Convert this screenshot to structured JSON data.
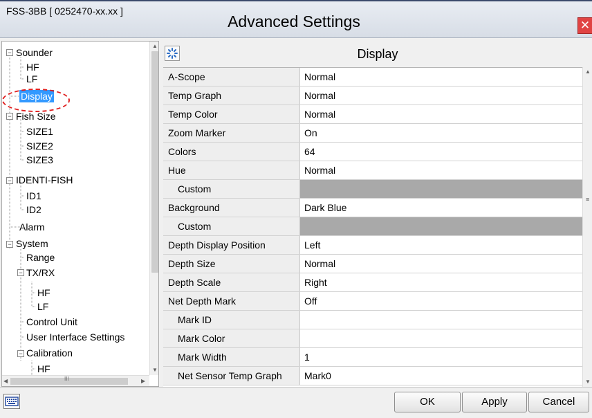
{
  "window": {
    "device_id": "FSS-3BB [ 0252470-xx.xx ]",
    "title": "Advanced Settings",
    "close_glyph": "✕"
  },
  "tree": {
    "items": [
      {
        "label": "Sounder",
        "expander": "−"
      },
      {
        "label": "HF"
      },
      {
        "label": "LF"
      },
      {
        "label": "Display",
        "selected": true
      },
      {
        "label": "Fish Size",
        "expander": "−"
      },
      {
        "label": "SIZE1"
      },
      {
        "label": "SIZE2"
      },
      {
        "label": "SIZE3"
      },
      {
        "label": "IDENTI-FISH",
        "expander": "−"
      },
      {
        "label": "ID1"
      },
      {
        "label": "ID2"
      },
      {
        "label": "Alarm"
      },
      {
        "label": "System",
        "expander": "−"
      },
      {
        "label": "Range"
      },
      {
        "label": "TX/RX",
        "expander": "−"
      },
      {
        "label": "HF"
      },
      {
        "label": "LF"
      },
      {
        "label": "Control Unit"
      },
      {
        "label": "User Interface Settings"
      },
      {
        "label": "Calibration",
        "expander": "−"
      },
      {
        "label": "HF"
      }
    ],
    "hscroll_grip": "III"
  },
  "panel": {
    "icon": "settings-icon",
    "title": "Display"
  },
  "settings": {
    "rows": [
      {
        "name": "A-Scope",
        "value": "Normal"
      },
      {
        "name": "Temp Graph",
        "value": "Normal"
      },
      {
        "name": "Temp Color",
        "value": "Normal"
      },
      {
        "name": "Zoom Marker",
        "value": "On"
      },
      {
        "name": "Colors",
        "value": "64"
      },
      {
        "name": "Hue",
        "value": "Normal"
      },
      {
        "name": "Custom",
        "value": "",
        "disabled": true
      },
      {
        "name": "Background",
        "value": "Dark Blue"
      },
      {
        "name": "Custom",
        "value": "",
        "disabled": true
      },
      {
        "name": "Depth Display Position",
        "value": "Left"
      },
      {
        "name": "Depth Size",
        "value": "Normal"
      },
      {
        "name": "Depth Scale",
        "value": "Right"
      },
      {
        "name": "Net Depth Mark",
        "value": "Off"
      },
      {
        "name": "Mark ID",
        "value": ""
      },
      {
        "name": "Mark Color",
        "value": ""
      },
      {
        "name": "Mark Width",
        "value": "1"
      },
      {
        "name": "Net Sensor Temp Graph",
        "value": "Mark0"
      }
    ]
  },
  "footer": {
    "keyboard_icon": "keyboard-icon",
    "ok_label": "OK",
    "apply_label": "Apply",
    "cancel_label": "Cancel"
  },
  "colors": {
    "selection": "#3399ff",
    "annotation": "#e02020",
    "close": "#e04343",
    "disabled_cell": "#a9a9a9"
  }
}
